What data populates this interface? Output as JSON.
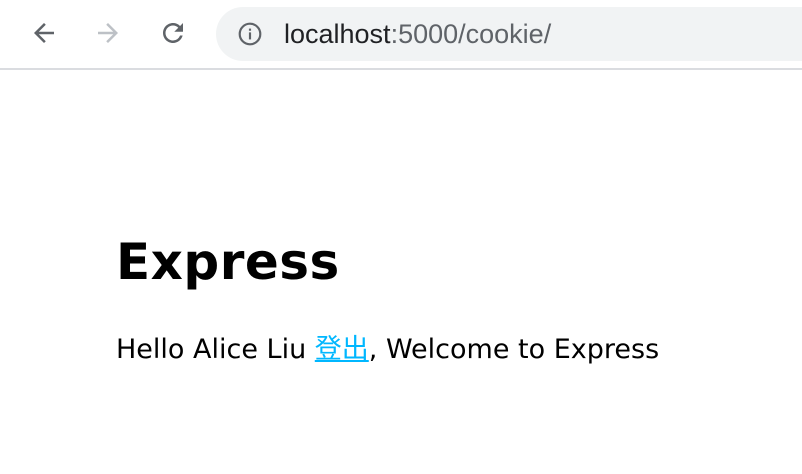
{
  "browser": {
    "url_host": "localhost",
    "url_path": ":5000/cookie/",
    "icons": {
      "back": "arrow-left-icon",
      "forward": "arrow-right-icon",
      "reload": "reload-icon",
      "info": "info-icon"
    },
    "colors": {
      "nav_active": "#5f6368",
      "nav_disabled": "#bdc1c6",
      "omnibox_bg": "#f1f3f4"
    }
  },
  "page": {
    "title": "Express",
    "greeting_prefix": "Hello Alice Liu ",
    "logout_label": "登出",
    "greeting_suffix": ", Welcome to Express",
    "link_color": "#00b7ff"
  }
}
